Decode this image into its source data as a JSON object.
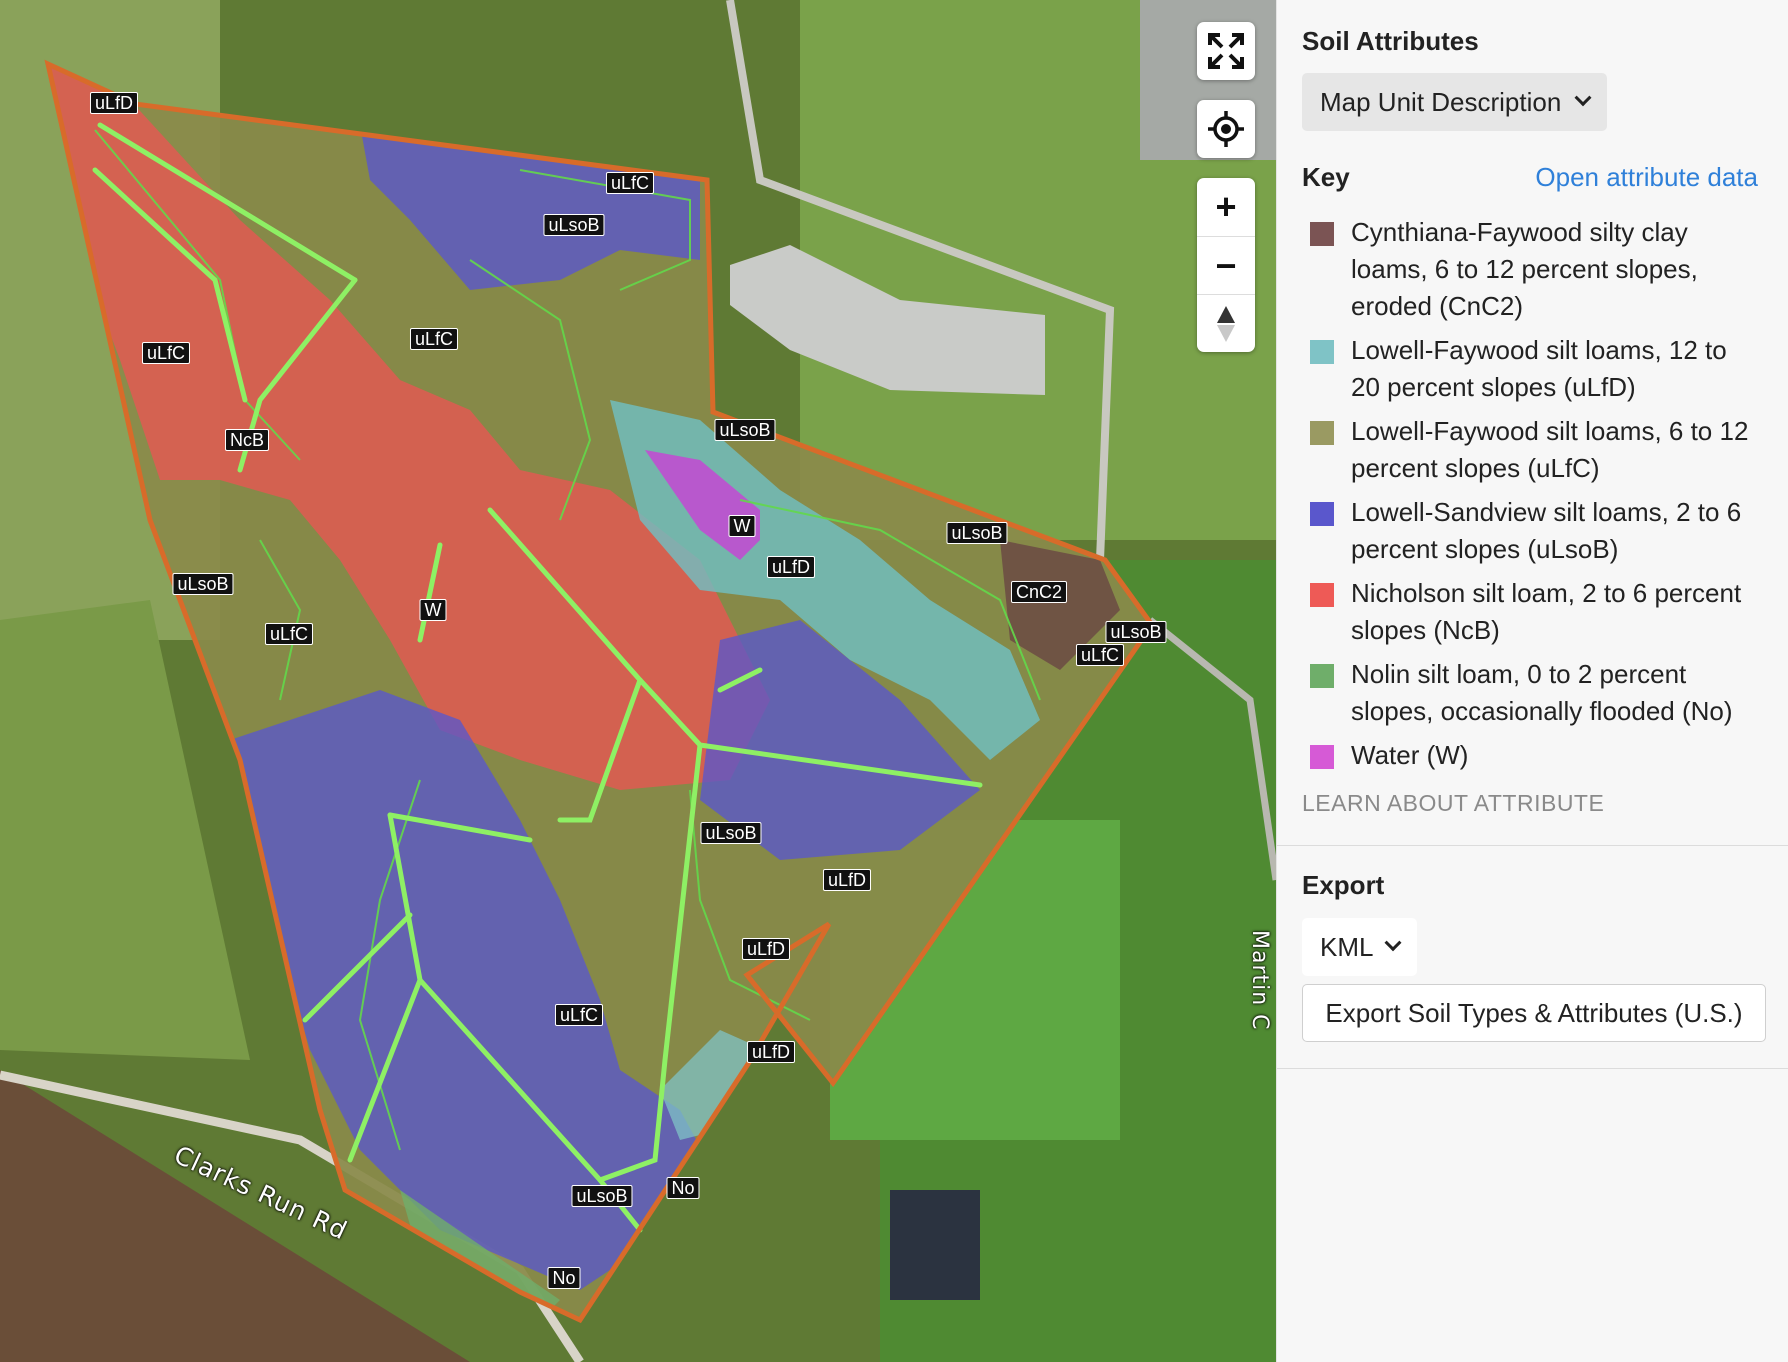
{
  "map": {
    "labels": [
      "uLfD",
      "uLfC",
      "uLsoB",
      "uLfC",
      "uLfC",
      "NcB",
      "uLsoB",
      "uLsoB",
      "uLfC",
      "W",
      "W",
      "uLfD",
      "uLsoB",
      "CnC2",
      "uLsoB",
      "uLfC",
      "uLsoB",
      "uLfD",
      "uLfD",
      "uLfC",
      "uLfD",
      "uLsoB",
      "No",
      "No"
    ],
    "road_label": "Clarks Run Rd",
    "side_road_label": "Martin C"
  },
  "controls": {
    "fullscreen": "fullscreen-icon",
    "locate": "locate-icon",
    "zoom_in": "+",
    "zoom_out": "−",
    "compass": "compass-icon"
  },
  "panel": {
    "title": "Soil Attributes",
    "dropdown_value": "Map Unit Description",
    "key_title": "Key",
    "open_link": "Open attribute data",
    "legend": [
      {
        "label": "Cynthiana-Faywood silty clay loams, 6 to 12 percent slopes, eroded (CnC2)",
        "color": "#7b5454"
      },
      {
        "label": "Lowell-Faywood silt loams, 12 to 20 percent slopes (uLfD)",
        "color": "#7fc3c6"
      },
      {
        "label": "Lowell-Faywood silt loams, 6 to 12 percent slopes (uLfC)",
        "color": "#9a9a62"
      },
      {
        "label": "Lowell-Sandview silt loams, 2 to 6 percent slopes (uLsoB)",
        "color": "#5a57cc"
      },
      {
        "label": "Nicholson silt loam, 2 to 6 percent slopes (NcB)",
        "color": "#ee5a56"
      },
      {
        "label": "Nolin silt loam, 0 to 2 percent slopes, occasionally flooded (No)",
        "color": "#6fae6a"
      },
      {
        "label": "Water (W)",
        "color": "#d65ad6"
      }
    ],
    "learn_link": "LEARN ABOUT ATTRIBUTE",
    "export_title": "Export",
    "export_format": "KML",
    "export_button": "Export Soil Types & Attributes (U.S.)"
  }
}
